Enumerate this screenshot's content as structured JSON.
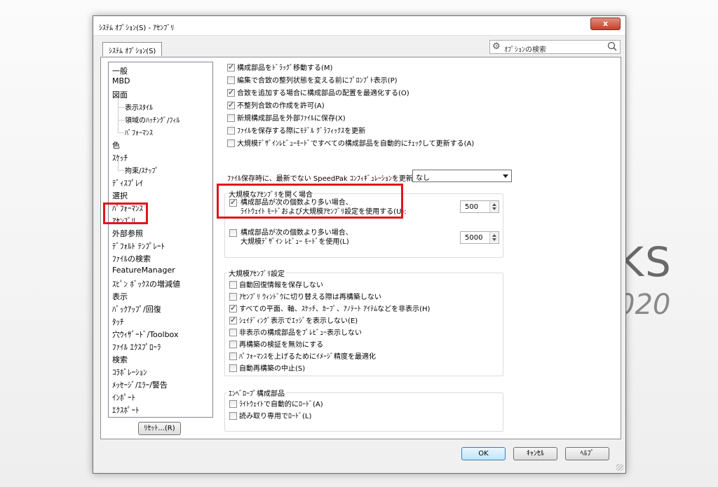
{
  "background": {
    "brand_fragment": "KS",
    "year_fragment": "020"
  },
  "dialog": {
    "title": "ｼｽﾃﾑ ｵﾌﾟｼｮﾝ(S) - ｱｾﾝﾌﾞﾘ",
    "close_label": "x",
    "tab": "ｼｽﾃﾑ ｵﾌﾟｼｮﾝ(S)",
    "search_placeholder": "ｵﾌﾟｼｮﾝの検索"
  },
  "tree": [
    {
      "label": "一般",
      "sub": false
    },
    {
      "label": "MBD",
      "sub": false
    },
    {
      "label": "図面",
      "sub": false
    },
    {
      "label": "表示ｽﾀｲﾙ",
      "sub": true
    },
    {
      "label": "領域のﾊｯﾁﾝｸﾞ/ﾌｨﾙ",
      "sub": true
    },
    {
      "label": "ﾊﾟﾌｫｰﾏﾝｽ",
      "sub": true
    },
    {
      "label": "色",
      "sub": false
    },
    {
      "label": "ｽｹｯﾁ",
      "sub": false
    },
    {
      "label": "拘束/ｽﾅｯﾌﾟ",
      "sub": true
    },
    {
      "label": "ﾃﾞｨｽﾌﾟﾚｲ",
      "sub": false
    },
    {
      "label": "選択",
      "sub": false
    },
    {
      "label": "ﾊﾟﾌｫｰﾏﾝｽ",
      "sub": false
    },
    {
      "label": "ｱｾﾝﾌﾞﾘ",
      "sub": false
    },
    {
      "label": "外部参照",
      "sub": false
    },
    {
      "label": "ﾃﾞﾌｫﾙﾄ ﾃﾝﾌﾟﾚｰﾄ",
      "sub": false
    },
    {
      "label": "ﾌｧｲﾙの検索",
      "sub": false
    },
    {
      "label": "FeatureManager",
      "sub": false
    },
    {
      "label": "ｽﾋﾟﾝ ﾎﾞｯｸｽの増減値",
      "sub": false
    },
    {
      "label": "表示",
      "sub": false
    },
    {
      "label": "ﾊﾞｯｸｱｯﾌﾟ/回復",
      "sub": false
    },
    {
      "label": "ﾀｯﾁ",
      "sub": false
    },
    {
      "label": "穴ｳｨｻﾞｰﾄﾞ/Toolbox",
      "sub": false
    },
    {
      "label": "ﾌｧｲﾙ ｴｸｽﾌﾟﾛｰﾗ",
      "sub": false
    },
    {
      "label": "検索",
      "sub": false
    },
    {
      "label": "ｺﾗﾎﾞﾚｰｼｮﾝ",
      "sub": false
    },
    {
      "label": "ﾒｯｾｰｼﾞ/ｴﾗｰ/警告",
      "sub": false
    },
    {
      "label": "ｲﾝﾎﾟｰﾄ",
      "sub": false
    },
    {
      "label": "ｴｸｽﾎﾟｰﾄ",
      "sub": false
    }
  ],
  "reset_label": "ﾘｾｯﾄ...(R)",
  "top_options": [
    {
      "label": "構成部品をﾄﾞﾗｯｸﾞ移動する(M)",
      "checked": true
    },
    {
      "label": "編集で合致の整列状態を変える前にﾌﾟﾛﾝﾌﾟﾄ表示(P)",
      "checked": false
    },
    {
      "label": "合致を追加する場合に構成部品の配置を最適化する(O)",
      "checked": true
    },
    {
      "label": "不整列合致の作成を許可(A)",
      "checked": true
    },
    {
      "label": "新規構成部品を外部ﾌｧｲﾙに保存(X)",
      "checked": false
    },
    {
      "label": "ﾌｧｲﾙを保存する際にﾓﾃﾞﾙ ｸﾞﾗﾌｨｯｸｽを更新",
      "checked": false
    },
    {
      "label": "大規模ﾃﾞｻﾞｲﾝﾚﾋﾞｭｰﾓｰﾄﾞですべての構成部品を自動的にﾁｪｯｸして更新する(A)",
      "checked": false
    }
  ],
  "speedpak": {
    "label": "ﾌｧｲﾙ保存時に、最新でない SpeedPak ｺﾝﾌｨｷﾞｭﾚｰｼｮﾝを更新:",
    "value": "なし"
  },
  "large_open": {
    "title": "大規模なｱｾﾝﾌﾞﾘを開く場合",
    "opt1": {
      "line1": "構成部品が次の個数より多い場合、",
      "line2": "ﾗｲﾄｳｪｲﾄ ﾓｰﾄﾞおよび大規模ｱｾﾝﾌﾞﾘ設定を使用する(U):",
      "checked": true,
      "value": "500"
    },
    "opt2": {
      "line1": "構成部品が次の個数より多い場合、",
      "line2": "大規模ﾃﾞｻﾞｲﾝ ﾚﾋﾞｭｰ ﾓｰﾄﾞを使用(L)",
      "checked": false,
      "value": "5000"
    }
  },
  "large_settings": {
    "title": "大規模ｱｾﾝﾌﾞﾘ設定",
    "items": [
      {
        "label": "自動回復情報を保存しない",
        "checked": false
      },
      {
        "label": "ｱｾﾝﾌﾞﾘ ｳｨﾝﾄﾞｳに切り替える際は再構築しない",
        "checked": false
      },
      {
        "label": "すべての平面、軸、ｽｹｯﾁ、ｶｰﾌﾞ、ｱﾉﾃｰﾄ ｱｲﾃﾑなどを非表示(H)",
        "checked": true
      },
      {
        "label": "ｼｪｲﾃﾞｨﾝｸﾞ表示でｴｯｼﾞを表示しない(E)",
        "checked": true
      },
      {
        "label": "非表示の構成部品をﾌﾟﾚﾋﾞｭｰ表示しない",
        "checked": false
      },
      {
        "label": "再構築の検証を無効にする",
        "checked": false
      },
      {
        "label": "ﾊﾟﾌｫｰﾏﾝｽを上げるためにｲﾒｰｼﾞ精度を最適化",
        "checked": false
      },
      {
        "label": "自動再構築の中止(S)",
        "checked": false
      }
    ]
  },
  "envelope": {
    "title": "ｴﾝﾍﾞﾛｰﾌﾟ構成部品",
    "items": [
      {
        "label": "ﾗｲﾄｳｪｲﾄで自動的にﾛｰﾄﾞ(A)",
        "checked": false
      },
      {
        "label": "読み取り専用でﾛｰﾄﾞ(L)",
        "checked": false
      }
    ]
  },
  "buttons": {
    "ok": "OK",
    "cancel": "ｷｬﾝｾﾙ",
    "help": "ﾍﾙﾌﾟ"
  }
}
